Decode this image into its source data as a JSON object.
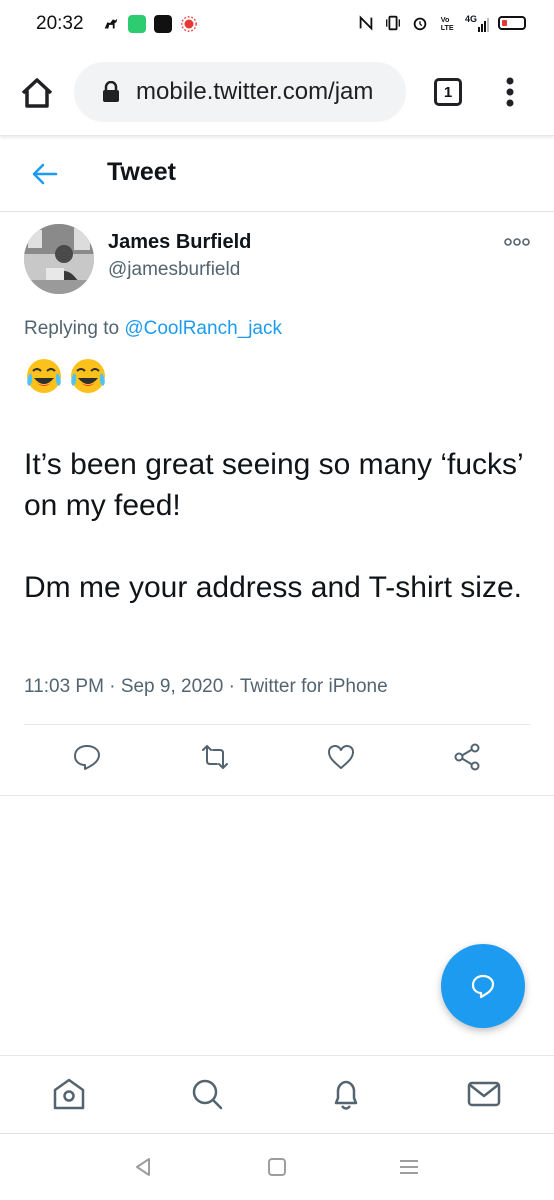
{
  "status_bar": {
    "time": "20:32",
    "left_icons": [
      "horse-icon",
      "battery-saver-icon",
      "app-icon",
      "recording-icon"
    ],
    "right_icons": [
      "nfc-icon",
      "vibrate-icon",
      "alarm-icon",
      "volte-icon",
      "signal-4g-icon",
      "battery-low-icon"
    ],
    "network_label": "4G"
  },
  "browser": {
    "url": "mobile.twitter.com/jam",
    "tab_count": "1"
  },
  "header": {
    "title": "Tweet"
  },
  "tweet": {
    "author_name": "James Burfield",
    "author_handle": "@jamesburfield",
    "replying_prefix": "Replying to ",
    "replying_to": "@CoolRanch_jack",
    "emoji": "😂😂",
    "paragraph_1": "It’s been great seeing so many ‘fucks’ on my feed!",
    "paragraph_2": "Dm me your address and T-shirt size.",
    "time": "11:03 PM",
    "separator": " · ",
    "date": "Sep 9, 2020",
    "source": "Twitter for iPhone"
  },
  "actions": [
    "reply-icon",
    "retweet-icon",
    "like-icon",
    "share-icon"
  ],
  "bottom_nav": [
    "home-icon",
    "search-icon",
    "notifications-icon",
    "messages-icon"
  ],
  "colors": {
    "accent": "#1d9bf0",
    "secondary_text": "#536471",
    "primary_text": "#0f1419"
  }
}
